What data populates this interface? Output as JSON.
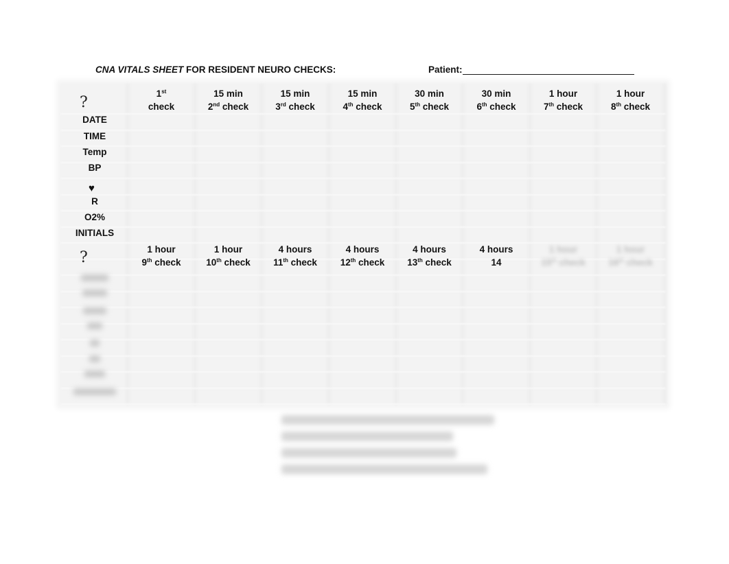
{
  "document": {
    "title_italic": "CNA VITALS SHEET",
    "title_rest": " FOR RESIDENT NEURO CHECKS:",
    "patient_label": "Patient:"
  },
  "table_top": {
    "corner_symbol": "?",
    "columns": [
      {
        "interval": "",
        "ordinal": "1",
        "suffix": "st",
        "word": "check"
      },
      {
        "interval": "15 min",
        "ordinal": "2",
        "suffix": "nd",
        "word": "check"
      },
      {
        "interval": "15 min",
        "ordinal": "3",
        "suffix": "rd",
        "word": "check"
      },
      {
        "interval": "15 min",
        "ordinal": "4",
        "suffix": "th",
        "word": "check"
      },
      {
        "interval": "30 min",
        "ordinal": "5",
        "suffix": "th",
        "word": "check"
      },
      {
        "interval": "30 min",
        "ordinal": "6",
        "suffix": "th",
        "word": "check"
      },
      {
        "interval": "1 hour",
        "ordinal": "7",
        "suffix": "th",
        "word": "check"
      },
      {
        "interval": "1 hour",
        "ordinal": "8",
        "suffix": "th",
        "word": "check"
      }
    ],
    "row_labels": [
      "DATE",
      "TIME",
      "Temp",
      "BP",
      "♥",
      "R",
      "O2%",
      "INITIALS"
    ]
  },
  "table_bottom": {
    "corner_symbol": "?",
    "columns": [
      {
        "interval": "1 hour",
        "ordinal": "9",
        "suffix": "th",
        "word": "check"
      },
      {
        "interval": "1 hour",
        "ordinal": "10",
        "suffix": "th",
        "word": "check"
      },
      {
        "interval": "4 hours",
        "ordinal": "11",
        "suffix": "th",
        "word": "check"
      },
      {
        "interval": "4 hours",
        "ordinal": "12",
        "suffix": "th",
        "word": "check"
      },
      {
        "interval": "4 hours",
        "ordinal": "13",
        "suffix": "th",
        "word": "check"
      },
      {
        "interval": "4 hours",
        "ordinal": "14",
        "suffix": "",
        "word": ""
      }
    ]
  }
}
